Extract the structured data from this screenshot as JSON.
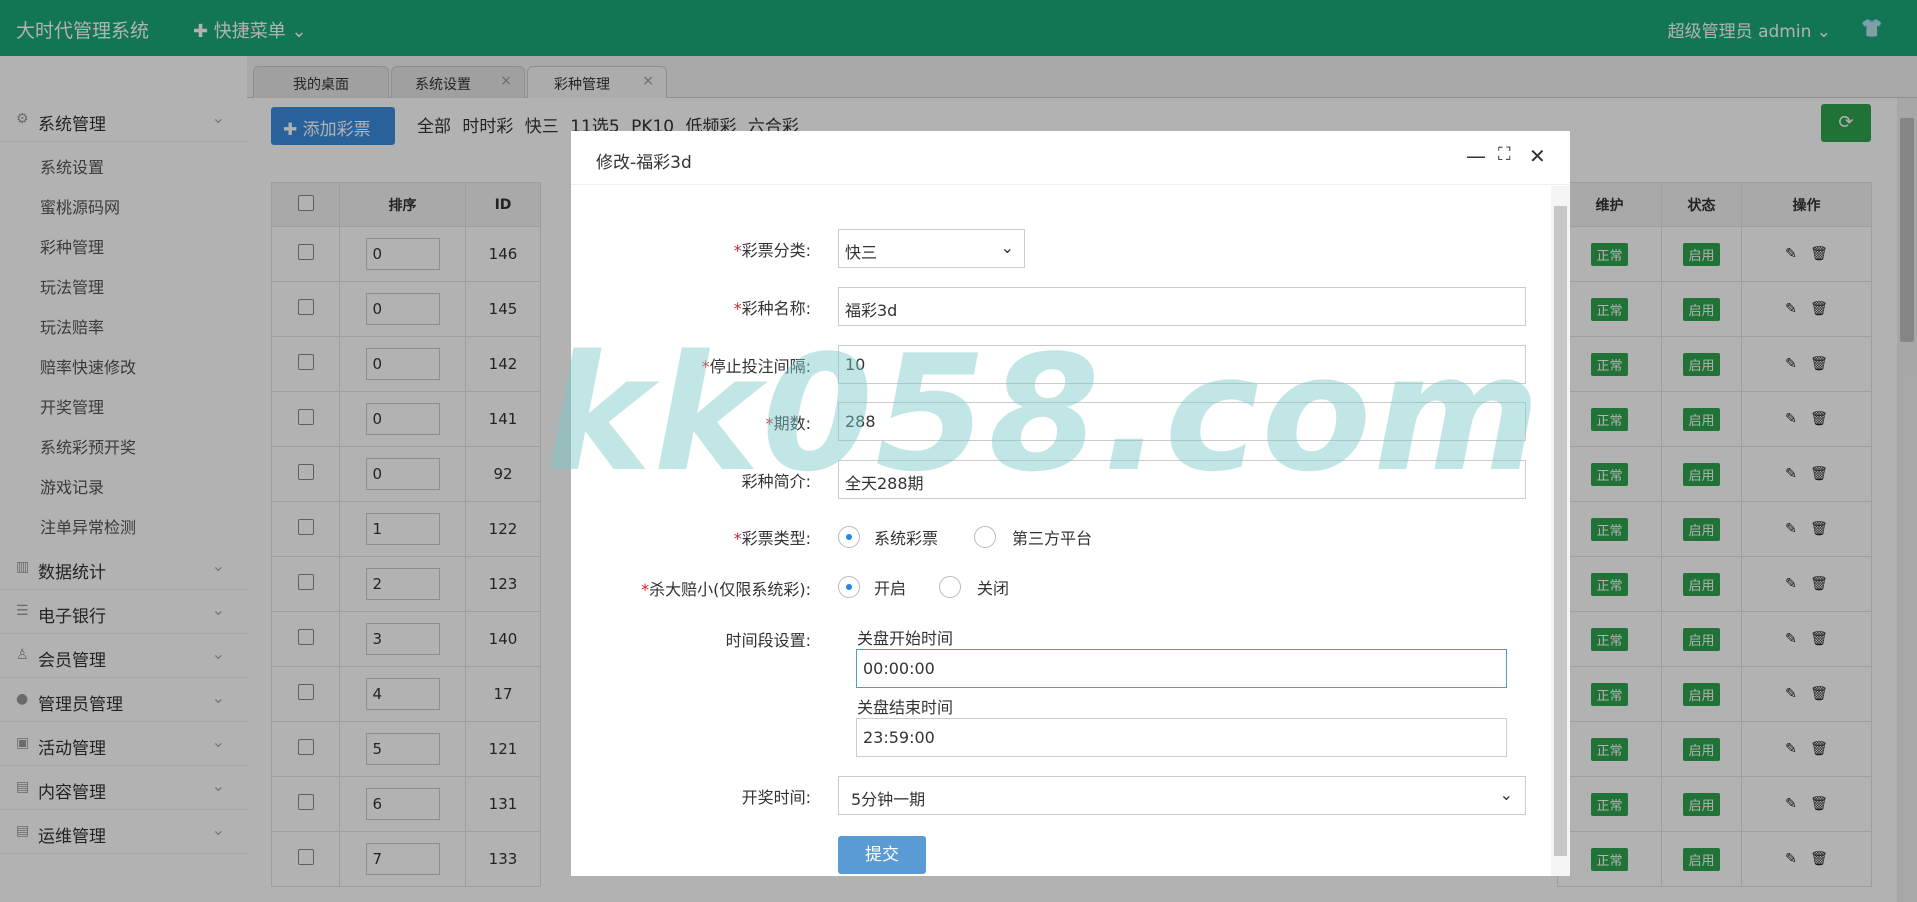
{
  "app": {
    "title": "大时代管理系统",
    "quick_menu": "✚ 快捷菜单 ⌄",
    "user": "超级管理员  admin ⌄"
  },
  "sidebar": {
    "groups": [
      {
        "label": "系统管理",
        "icon": "gear-icon"
      },
      {
        "label": "数据统计",
        "icon": "chart-icon"
      },
      {
        "label": "电子银行",
        "icon": "list-icon"
      },
      {
        "label": "会员管理",
        "icon": "user-icon"
      },
      {
        "label": "管理员管理",
        "icon": "admin-icon"
      },
      {
        "label": "活动管理",
        "icon": "gift-icon"
      },
      {
        "label": "内容管理",
        "icon": "doc-icon"
      },
      {
        "label": "运维管理",
        "icon": "doc-icon"
      }
    ],
    "items": [
      "系统设置",
      "蜜桃源码网",
      "彩种管理",
      "玩法管理",
      "玩法赔率",
      "赔率快速修改",
      "开奖管理",
      "系统彩预开奖",
      "游戏记录",
      "注单异常检测"
    ]
  },
  "tabs": [
    {
      "label": "我的桌面"
    },
    {
      "label": "系统设置"
    },
    {
      "label": "彩种管理"
    }
  ],
  "toolbar": {
    "add_label": "✚ 添加彩票",
    "filters": "全部 时时彩 快三 11选5 PK10 低频彩 六合彩"
  },
  "table": {
    "headers": {
      "sort": "排序",
      "id": "ID",
      "maint": "维护",
      "status": "状态",
      "ops": "操作"
    },
    "rows": [
      {
        "sort": "0",
        "id": "146"
      },
      {
        "sort": "0",
        "id": "145"
      },
      {
        "sort": "0",
        "id": "142"
      },
      {
        "sort": "0",
        "id": "141"
      },
      {
        "sort": "0",
        "id": "92"
      },
      {
        "sort": "1",
        "id": "122"
      },
      {
        "sort": "2",
        "id": "123"
      },
      {
        "sort": "3",
        "id": "140"
      },
      {
        "sort": "4",
        "id": "17"
      },
      {
        "sort": "5",
        "id": "121"
      },
      {
        "sort": "6",
        "id": "131"
      },
      {
        "sort": "7",
        "id": "133"
      }
    ],
    "maint_badge": "正常",
    "status_badge": "启用"
  },
  "watermark": "kk058.com",
  "modal": {
    "title": "修改-福彩3d",
    "fields": {
      "category": {
        "label": "彩票分类:",
        "value": "快三"
      },
      "name": {
        "label": "彩种名称:",
        "value": "福彩3d"
      },
      "interval": {
        "label": "停止投注间隔:",
        "value": "10"
      },
      "periods": {
        "label": "期数:",
        "value": "288"
      },
      "intro": {
        "label": "彩种简介:",
        "value": "全天288期"
      },
      "type": {
        "label": "彩票类型:",
        "opt1": "系统彩票",
        "opt2": "第三方平台"
      },
      "kill": {
        "label": "杀大赔小(仅限系统彩):",
        "opt1": "开启",
        "opt2": "关闭"
      },
      "period": {
        "label": "时间段设置:",
        "start_label": "关盘开始时间",
        "start": "00:00:00",
        "end_label": "关盘结束时间",
        "end": "23:59:00"
      },
      "draw": {
        "label": "开奖时间:",
        "value": "5分钟一期"
      }
    },
    "submit": "提交"
  }
}
